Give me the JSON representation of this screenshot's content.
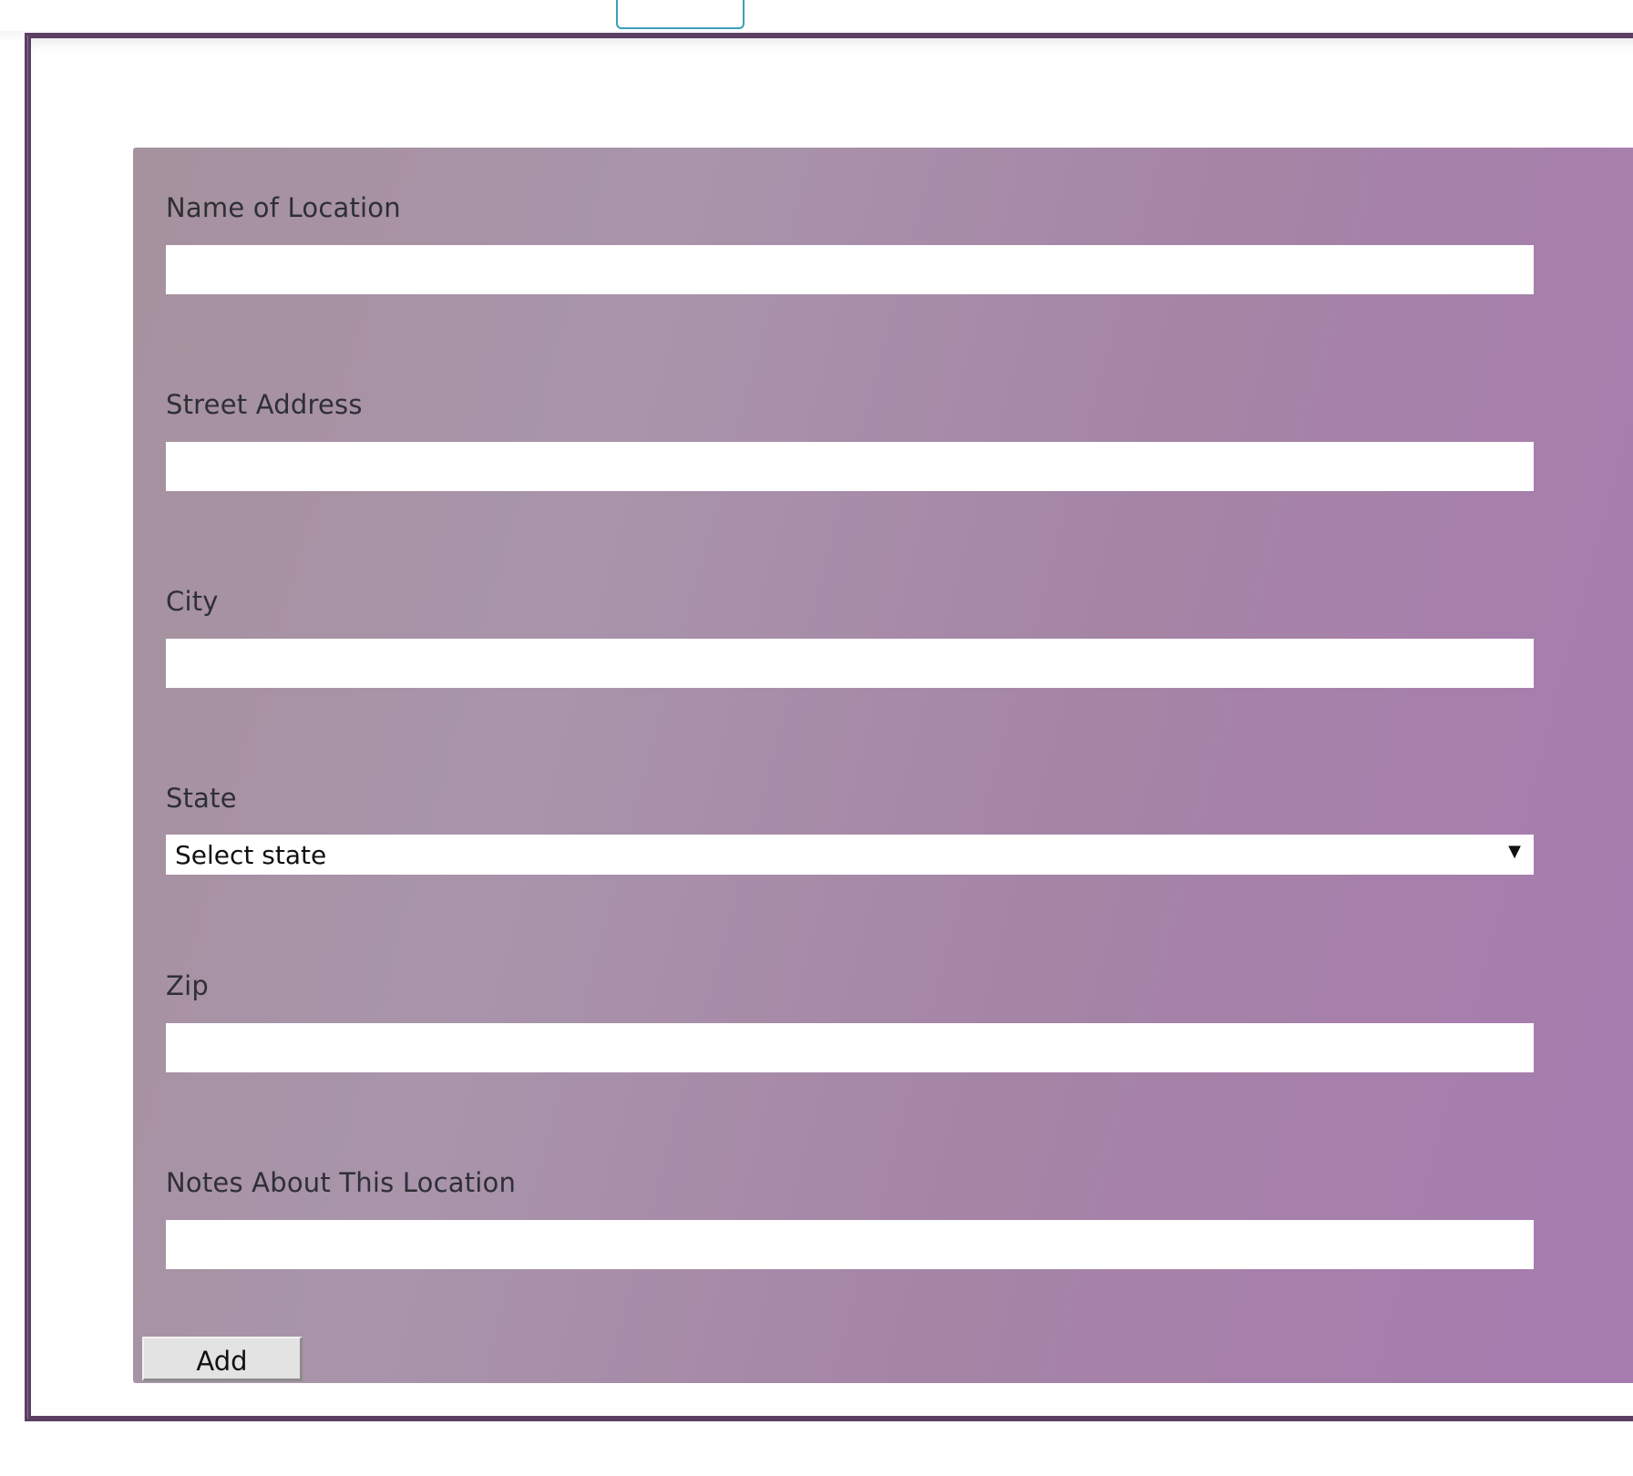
{
  "form": {
    "fields": [
      {
        "label": "Name of Location",
        "value": "",
        "placeholder": ""
      },
      {
        "label": "Street Address",
        "value": "",
        "placeholder": ""
      },
      {
        "label": "City",
        "value": "",
        "placeholder": ""
      },
      {
        "label": "State",
        "selected": "Select state"
      },
      {
        "label": "Zip",
        "value": "",
        "placeholder": ""
      },
      {
        "label": "Notes About This Location",
        "value": "",
        "placeholder": ""
      }
    ],
    "add_label": "Add"
  },
  "icons": {
    "select_arrow": "▼"
  },
  "colors": {
    "frame": "#5b3f63",
    "panel_gradient_start": "#a6919e",
    "panel_gradient_end": "#a77bb0",
    "top_tab_border": "#3aa0b8"
  }
}
